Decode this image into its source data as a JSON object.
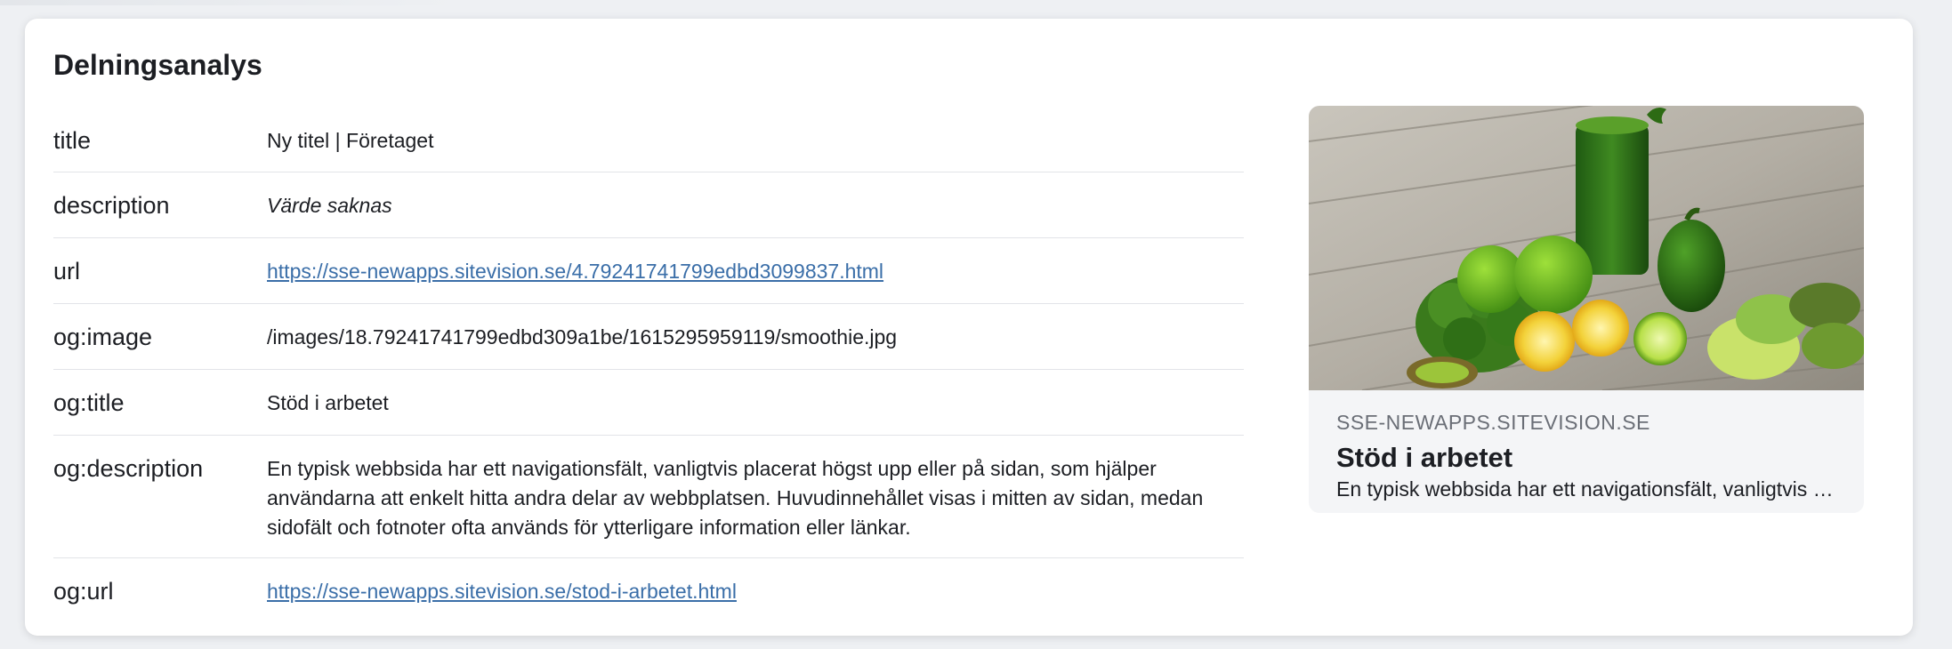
{
  "panel": {
    "title": "Delningsanalys"
  },
  "rows": [
    {
      "key": "title",
      "value": "Ny titel | Företaget"
    },
    {
      "key": "description",
      "value": "Värde saknas"
    },
    {
      "key": "url",
      "value": "https://sse-newapps.sitevision.se/4.79241741799edbd3099837.html"
    },
    {
      "key": "og:image",
      "value": "/images/18.79241741799edbd309a1be/1615295959119/smoothie.jpg"
    },
    {
      "key": "og:title",
      "value": "Stöd i arbetet"
    },
    {
      "key": "og:description",
      "value": "En typisk webbsida har ett navigationsfält, vanligtvis placerat högst upp eller på sidan, som hjälper användarna att enkelt hitta andra delar av webbplatsen. Huvudinnehållet visas i mitten av sidan, medan sidofält och fotnoter ofta används för ytterligare information eller länkar."
    },
    {
      "key": "og:url",
      "value": "https://sse-newapps.sitevision.se/stod-i-arbetet.html"
    }
  ],
  "preview": {
    "domain": "SSE-NEWAPPS.SITEVISION.SE",
    "title": "Stöd i arbetet",
    "description": "En typisk webbsida har ett navigationsfält, vanligtvis placerat högst upp eller på sidan, som hjälper användarna att enkelt hitta andra delar av webbplatsen."
  },
  "colors": {
    "link": "#3a6ea8",
    "card_bg": "#ffffff",
    "page_bg": "#eef0f3",
    "preview_bg": "#f4f5f7"
  }
}
